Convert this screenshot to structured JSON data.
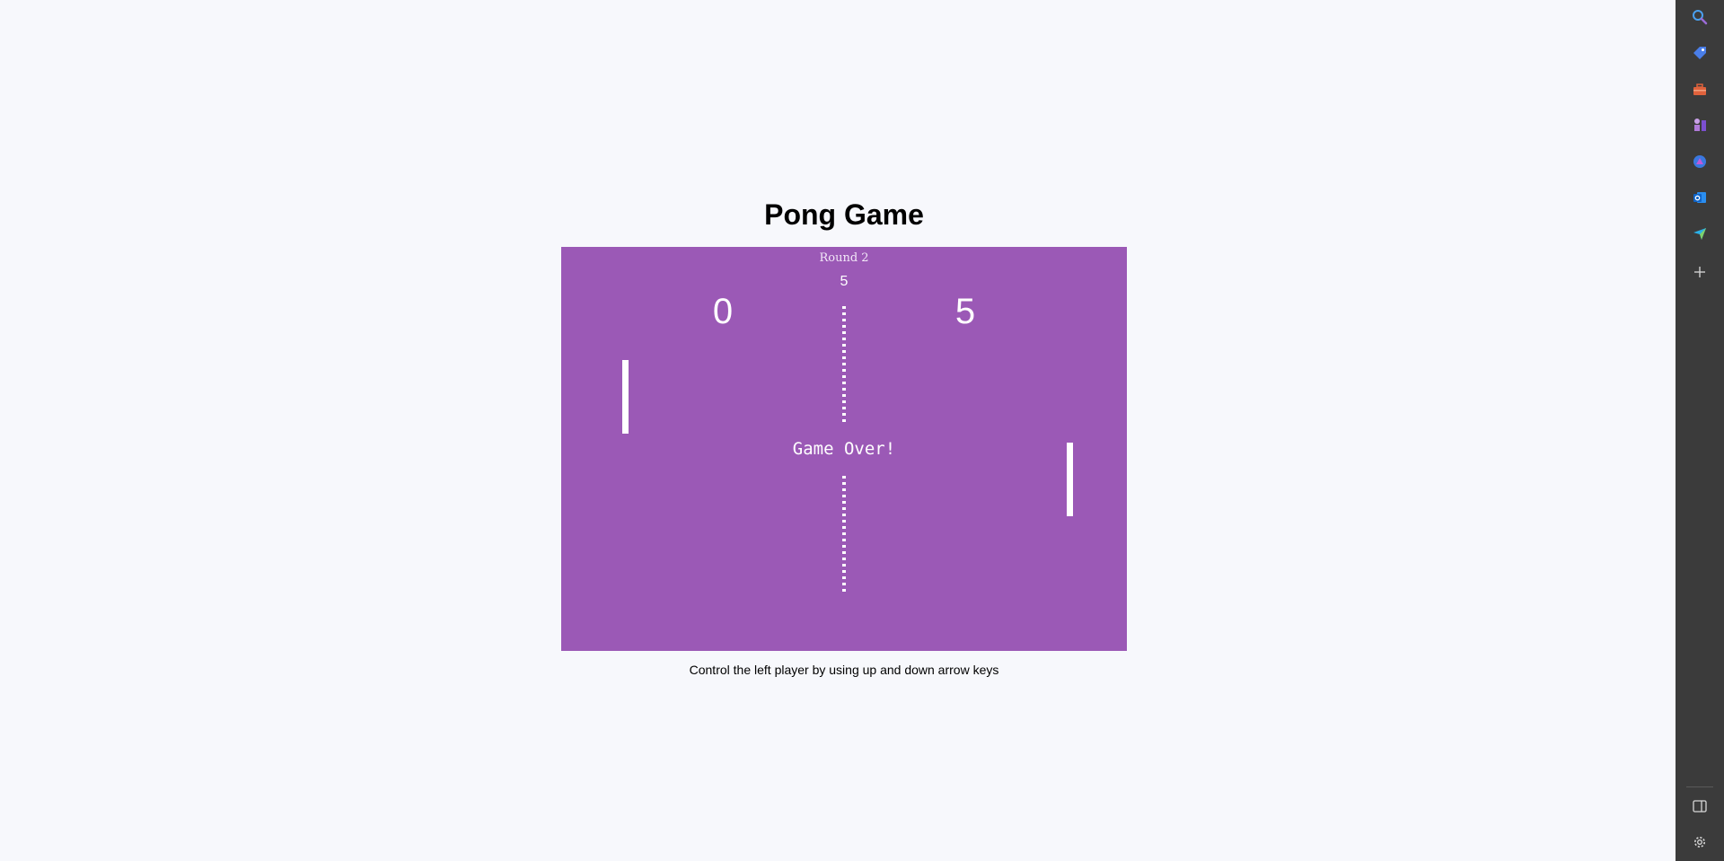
{
  "page": {
    "title": "Pong Game",
    "instructions": "Control the left player by using up and down arrow keys"
  },
  "game": {
    "round_label": "Round 2",
    "top_number": "5",
    "left_score": "0",
    "right_score": "5",
    "status": "Game Over!",
    "board_color": "#9b59b6"
  },
  "sidebar": {
    "icons": [
      "search-icon",
      "tag-icon",
      "toolbox-icon",
      "chess-icon",
      "copilot-icon",
      "outlook-icon",
      "send-icon",
      "add-icon"
    ],
    "bottom_icons": [
      "sidebar-toggle-icon",
      "settings-icon"
    ]
  }
}
